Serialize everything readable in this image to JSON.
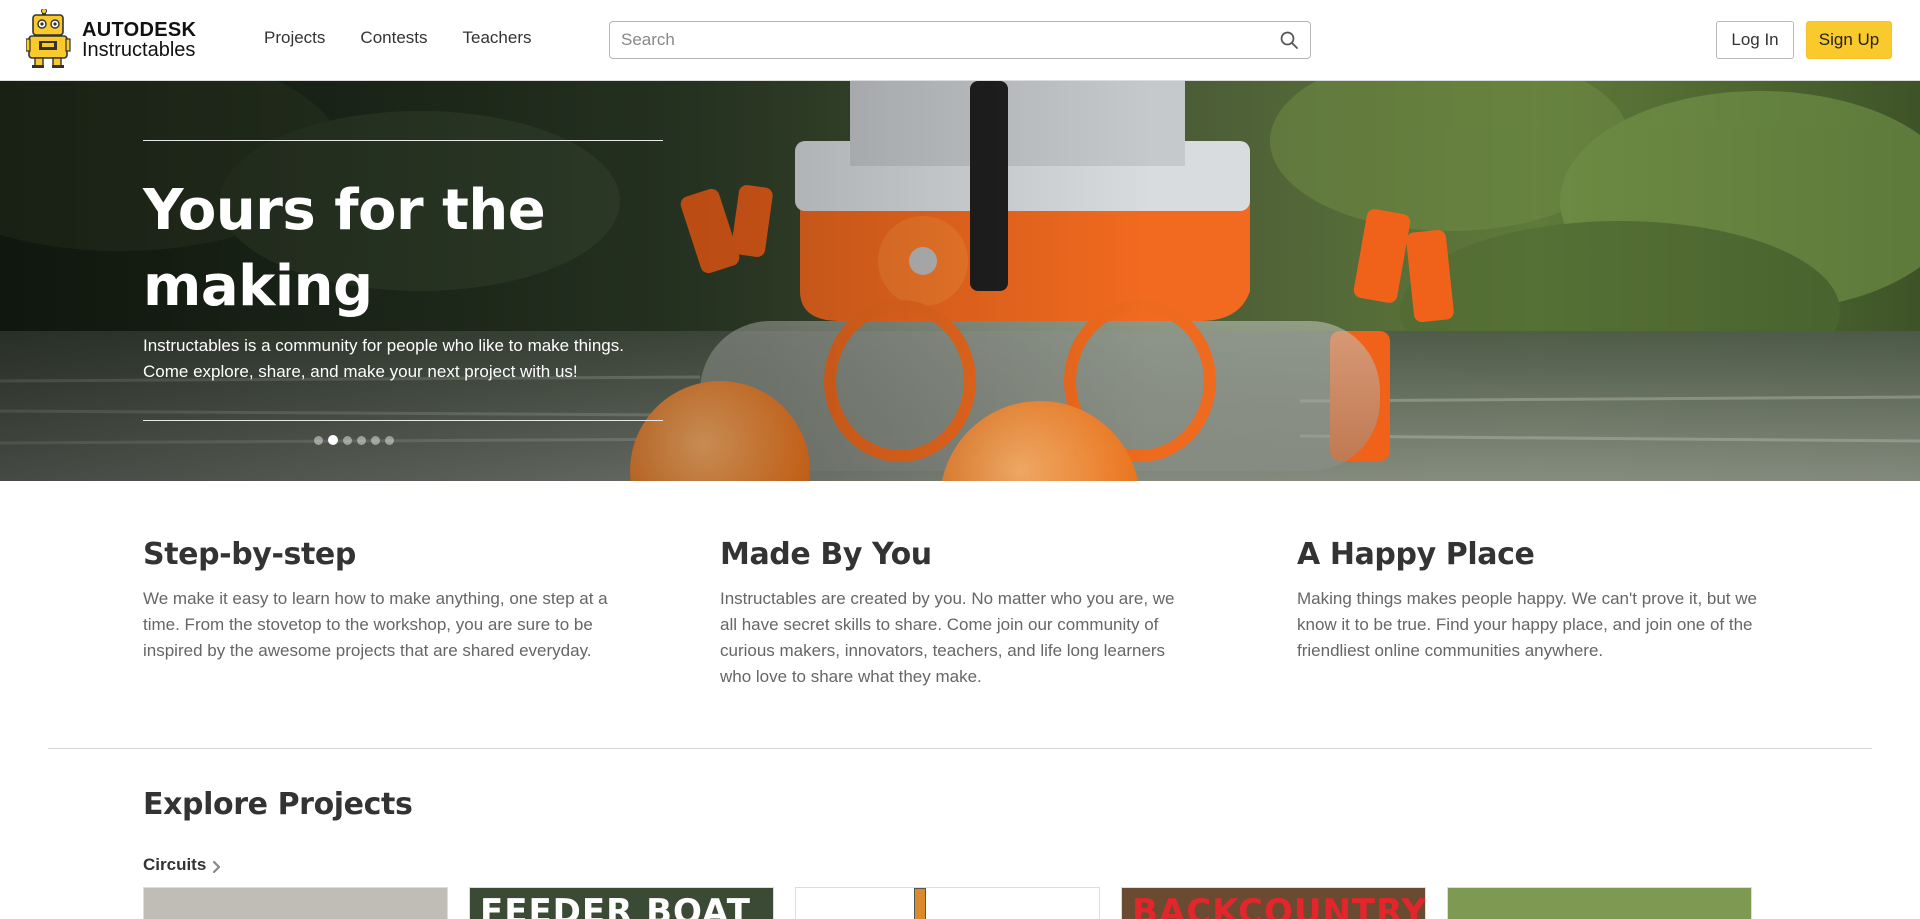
{
  "header": {
    "logo_brand": "AUTODESK",
    "logo_name": "Instructables",
    "nav": [
      "Projects",
      "Contests",
      "Teachers"
    ],
    "search_placeholder": "Search",
    "login_label": "Log In",
    "signup_label": "Sign Up",
    "signup_color": "#fac92c"
  },
  "hero": {
    "title": "Yours for the making",
    "subtitle": "Instructables is a community for people who like to make things. Come explore, share, and make your next project with us!",
    "slides_count": 6,
    "active_slide_index": 1
  },
  "features": [
    {
      "title": "Step-by-step",
      "text": "We make it easy to learn how to make anything, one step at a time. From the stovetop to the workshop, you are sure to be inspired by the awesome projects that are shared everyday."
    },
    {
      "title": "Made By You",
      "text": "Instructables are created by you. No matter who you are, we all have secret skills to share. Come join our community of curious makers, innovators, teachers, and life long learners who love to share what they make."
    },
    {
      "title": "A Happy Place",
      "text": "Making things makes people happy. We can't prove it, but we know it to be true. Find your happy place, and join one of the friendliest online communities anywhere."
    }
  ],
  "explore": {
    "title": "Explore Projects",
    "category": "Circuits",
    "cards": [
      {
        "text": "",
        "bg": "#bfbdb6"
      },
      {
        "text": "FEEDER BOAT",
        "bg": "#3b4a35",
        "text_color": "#ffffff"
      },
      {
        "text": "",
        "bg": "#ffffff"
      },
      {
        "text": "BACKCOUNTRY",
        "bg": "#6a4a30",
        "text_color": "#e3262b"
      },
      {
        "text": "",
        "bg": "#7e9a52"
      }
    ]
  }
}
